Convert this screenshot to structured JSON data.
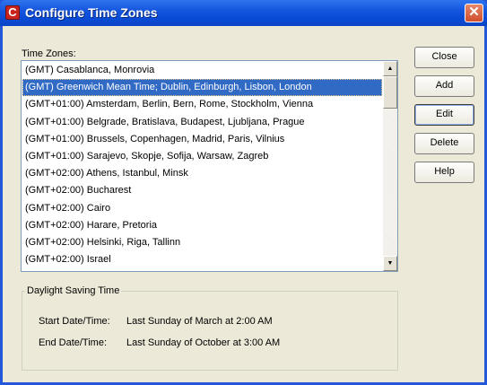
{
  "window": {
    "title": "Configure Time Zones",
    "app_icon_letter": "C",
    "close_glyph": "✕"
  },
  "timezones": {
    "label": "Time Zones:",
    "items": [
      "(GMT) Casablanca, Monrovia",
      "(GMT) Greenwich Mean Time; Dublin, Edinburgh, Lisbon, London",
      "(GMT+01:00) Amsterdam, Berlin, Bern, Rome, Stockholm, Vienna",
      "(GMT+01:00) Belgrade, Bratislava, Budapest, Ljubljana, Prague",
      "(GMT+01:00) Brussels, Copenhagen, Madrid, Paris, Vilnius",
      "(GMT+01:00) Sarajevo, Skopje, Sofija, Warsaw, Zagreb",
      "(GMT+02:00) Athens, Istanbul, Minsk",
      "(GMT+02:00) Bucharest",
      "(GMT+02:00) Cairo",
      "(GMT+02:00) Harare, Pretoria",
      "(GMT+02:00) Helsinki, Riga, Tallinn",
      "(GMT+02:00) Israel"
    ],
    "selected_index": 1
  },
  "dst": {
    "legend": "Daylight Saving Time",
    "start_label": "Start Date/Time:",
    "start_value": "Last Sunday of March at 2:00 AM",
    "end_label": "End Date/Time:",
    "end_value": "Last Sunday of October at 3:00 AM"
  },
  "buttons": {
    "close": "Close",
    "add": "Add",
    "edit": "Edit",
    "delete": "Delete",
    "help": "Help"
  },
  "colors": {
    "titlebar": "#0a4bd6",
    "selection": "#316ac5",
    "dialog_face": "#ece9d8"
  }
}
